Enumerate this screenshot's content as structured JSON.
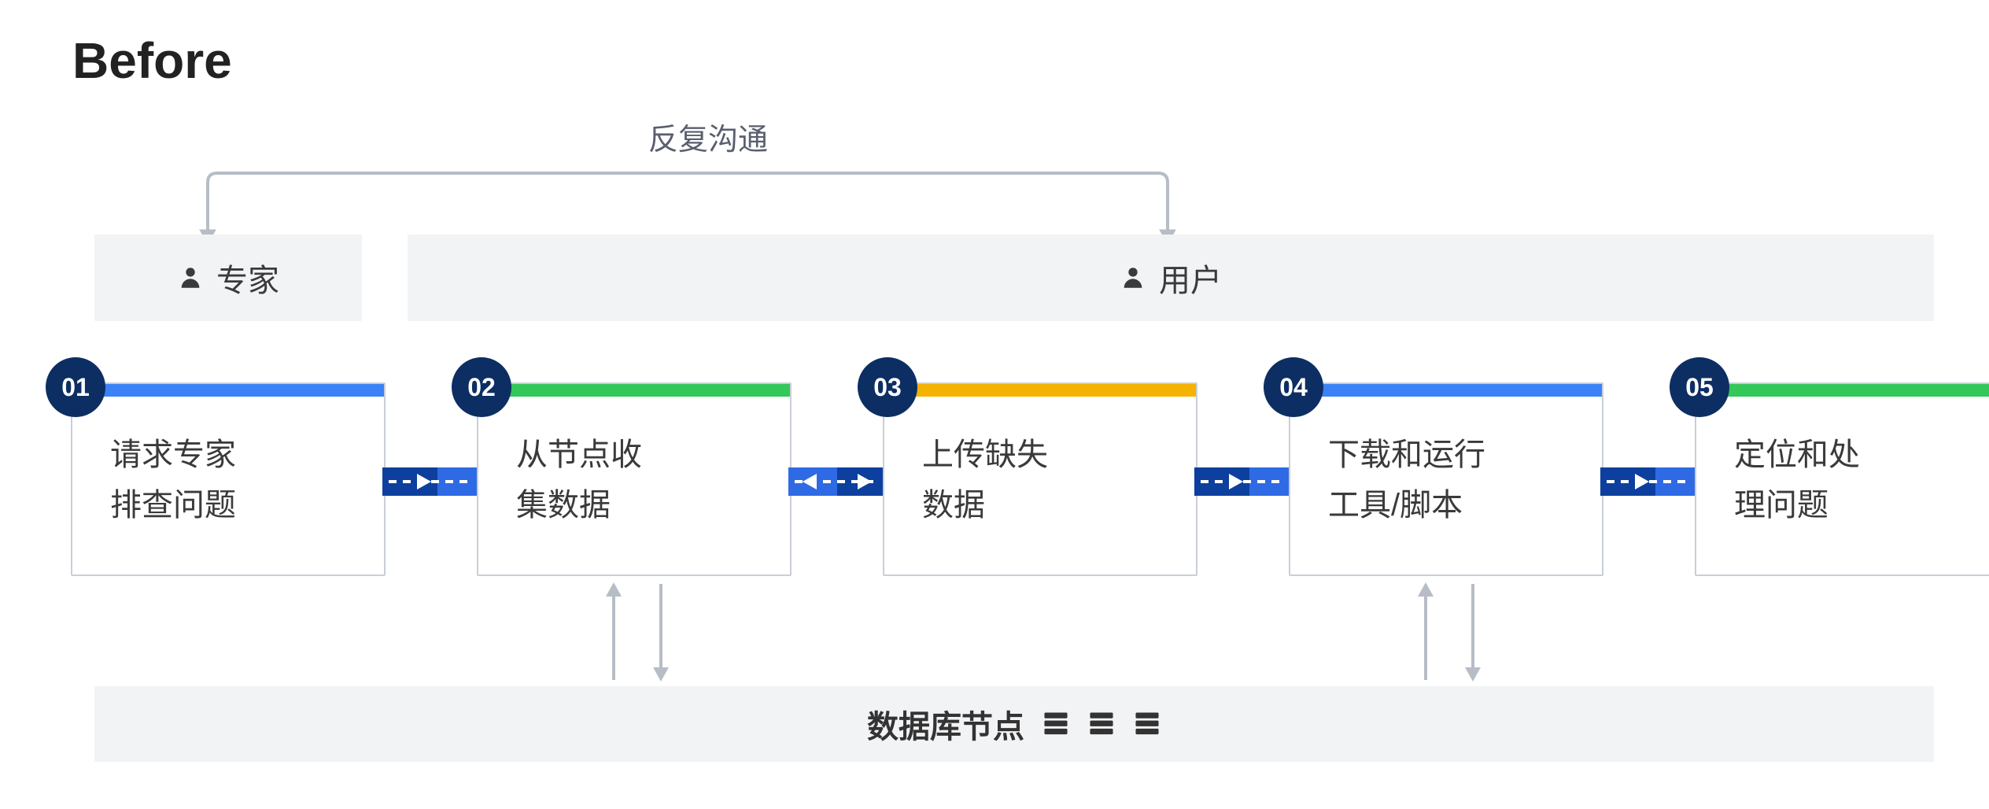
{
  "title": "Before",
  "feedback_label": "反复沟通",
  "roles": {
    "expert": "专家",
    "user": "用户"
  },
  "steps": [
    {
      "num": "01",
      "line1": "请求专家",
      "line2": "排查问题",
      "bar": "blue"
    },
    {
      "num": "02",
      "line1": "从节点收",
      "line2": "集数据",
      "bar": "green"
    },
    {
      "num": "03",
      "line1": "上传缺失",
      "line2": "数据",
      "bar": "amber"
    },
    {
      "num": "04",
      "line1": "下载和运行",
      "line2": "工具/脚本",
      "bar": "blue"
    },
    {
      "num": "05",
      "line1": "定位和处",
      "line2": "理问题",
      "bar": "green"
    }
  ],
  "datastore_label": "数据库节点",
  "colors": {
    "badge": "#0d2e63",
    "blue": "#3b82f6",
    "green": "#34c759",
    "amber": "#f5b301",
    "chip": "#f2f3f5",
    "arrow_blue_dark": "#0d3f9e",
    "arrow_blue_light": "#2f6ae5",
    "grey": "#b7bdc6"
  }
}
